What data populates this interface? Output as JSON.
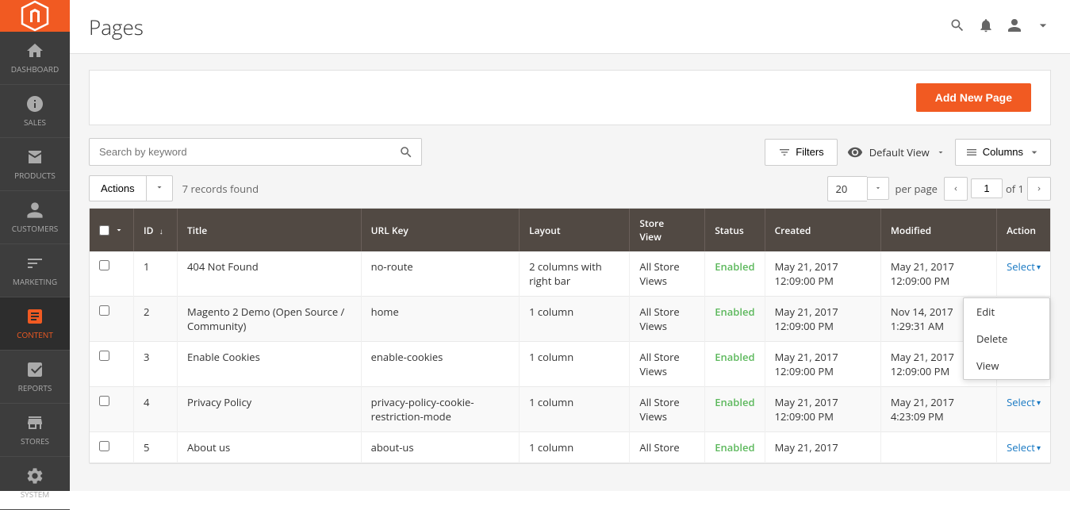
{
  "sidebar": {
    "logo_alt": "Magento Logo",
    "items": [
      {
        "id": "dashboard",
        "label": "DASHBOARD",
        "icon": "dashboard"
      },
      {
        "id": "sales",
        "label": "SALES",
        "icon": "sales"
      },
      {
        "id": "products",
        "label": "PRODUCTS",
        "icon": "products"
      },
      {
        "id": "customers",
        "label": "CUSTOMERS",
        "icon": "customers"
      },
      {
        "id": "marketing",
        "label": "MARKETING",
        "icon": "marketing"
      },
      {
        "id": "content",
        "label": "CONTENT",
        "icon": "content",
        "active": true
      },
      {
        "id": "reports",
        "label": "REPORTS",
        "icon": "reports"
      },
      {
        "id": "stores",
        "label": "STORES",
        "icon": "stores"
      },
      {
        "id": "system",
        "label": "SYSTEM",
        "icon": "system"
      }
    ]
  },
  "header": {
    "title": "Pages",
    "search_icon": "search",
    "notification_icon": "bell",
    "user_icon": "user",
    "chevron_icon": "chevron-down"
  },
  "toolbar": {
    "add_new_label": "Add New Page"
  },
  "filters": {
    "search_placeholder": "Search by keyword",
    "filters_label": "Filters",
    "default_view_label": "Default View",
    "columns_label": "Columns"
  },
  "actions_bar": {
    "actions_label": "Actions",
    "records_found": "7 records found",
    "per_page_value": "20",
    "per_page_label": "per page",
    "page_current": "1",
    "page_total": "of 1"
  },
  "table": {
    "columns": [
      "",
      "ID",
      "Title",
      "URL Key",
      "Layout",
      "Store View",
      "Status",
      "Created",
      "Modified",
      "Action"
    ],
    "rows": [
      {
        "id": "1",
        "title": "404 Not Found",
        "url_key": "no-route",
        "layout": "2 columns with right bar",
        "store_view": "All Store Views",
        "status": "Enabled",
        "created": "May 21, 2017 12:09:00 PM",
        "modified": "May 21, 2017 12:09:00 PM",
        "action": "Select",
        "dropdown_open": true
      },
      {
        "id": "2",
        "title": "Magento 2 Demo (Open Source / Community)",
        "url_key": "home",
        "layout": "1 column",
        "store_view": "All Store Views",
        "status": "Enabled",
        "created": "May 21, 2017 12:09:00 PM",
        "modified": "Nov 14, 2017 1:29:31 AM",
        "action": "Select",
        "dropdown_open": false
      },
      {
        "id": "3",
        "title": "Enable Cookies",
        "url_key": "enable-cookies",
        "layout": "1 column",
        "store_view": "All Store Views",
        "status": "Enabled",
        "created": "May 21, 2017 12:09:00 PM",
        "modified": "May 21, 2017 12:09:00 PM",
        "action": "Select",
        "dropdown_open": false
      },
      {
        "id": "4",
        "title": "Privacy Policy",
        "url_key": "privacy-policy-cookie-restriction-mode",
        "layout": "1 column",
        "store_view": "All Store Views",
        "status": "Enabled",
        "created": "May 21, 2017 12:09:00 PM",
        "modified": "May 21, 2017 4:23:09 PM",
        "action": "Select",
        "dropdown_open": false
      },
      {
        "id": "5",
        "title": "About us",
        "url_key": "about-us",
        "layout": "1 column",
        "store_view": "All Store",
        "status": "Enabled",
        "created": "May 21, 2017",
        "modified": "",
        "action": "Select",
        "dropdown_open": false
      }
    ],
    "dropdown_items": [
      "Edit",
      "Delete",
      "View"
    ]
  },
  "colors": {
    "sidebar_bg": "#3d3d3d",
    "logo_bg": "#f15a22",
    "header_bg": "#514943",
    "add_new_bg": "#f15a22",
    "enabled_color": "#5cb85c",
    "link_color": "#1979c3"
  }
}
